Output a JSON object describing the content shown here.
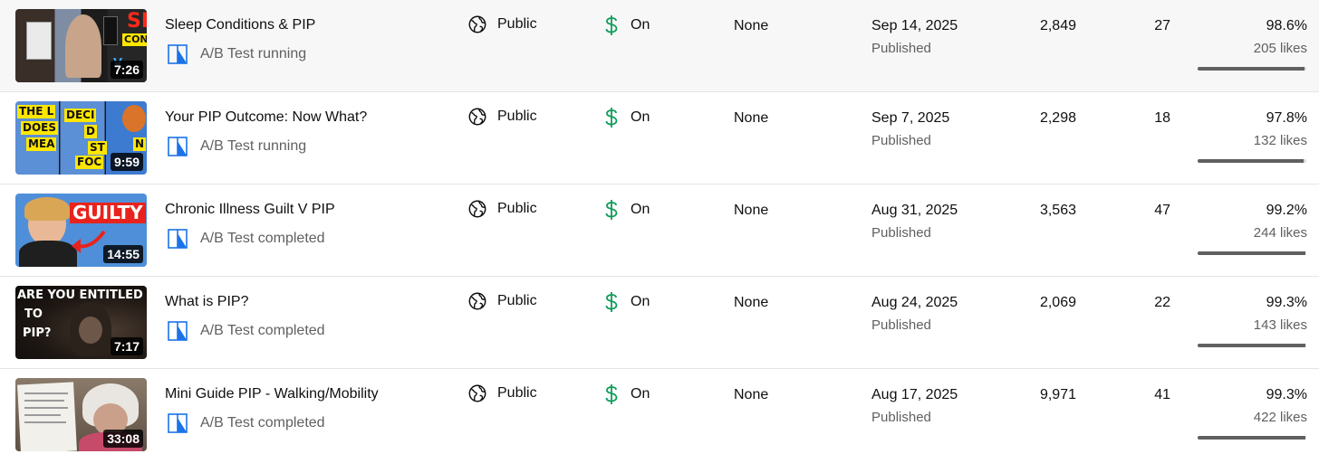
{
  "colors": {
    "ab_icon_blue": "#1a73e8",
    "dollar_green": "#0f9d58",
    "bar_fill": "#606060",
    "bar_track": "#d9d9d9"
  },
  "icons": {
    "visibility": "globe-icon",
    "monetization": "dollar-icon",
    "ab_test": "ab-test-icon"
  },
  "videos": [
    {
      "title": "Sleep Conditions & PIP",
      "ab_status": "A/B Test running",
      "duration": "7:26",
      "thumb_text": [
        "SL",
        "CONDI",
        "V"
      ],
      "visibility": "Public",
      "monetization": "On",
      "restrictions": "None",
      "date": "Sep 14, 2025",
      "date_status": "Published",
      "views": "2,849",
      "comments": "27",
      "likes_pct": "98.6%",
      "likes_count": "205 likes",
      "likes_fraction": 0.986
    },
    {
      "title": "Your PIP Outcome: Now What?",
      "ab_status": "A/B Test running",
      "duration": "9:59",
      "thumb_text": [
        "THE L",
        "DOES",
        "MEA",
        "DECI",
        "D",
        "ST",
        "FOC",
        "N"
      ],
      "visibility": "Public",
      "monetization": "On",
      "restrictions": "None",
      "date": "Sep 7, 2025",
      "date_status": "Published",
      "views": "2,298",
      "comments": "18",
      "likes_pct": "97.8%",
      "likes_count": "132 likes",
      "likes_fraction": 0.978
    },
    {
      "title": "Chronic Illness Guilt V PIP",
      "ab_status": "A/B Test completed",
      "duration": "14:55",
      "thumb_text": [
        "GUILTY"
      ],
      "visibility": "Public",
      "monetization": "On",
      "restrictions": "None",
      "date": "Aug 31, 2025",
      "date_status": "Published",
      "views": "3,563",
      "comments": "47",
      "likes_pct": "99.2%",
      "likes_count": "244 likes",
      "likes_fraction": 0.992
    },
    {
      "title": "What is PIP?",
      "ab_status": "A/B Test completed",
      "duration": "7:17",
      "thumb_text": [
        "ARE YOU ENTITLED",
        "TO",
        "PIP?"
      ],
      "visibility": "Public",
      "monetization": "On",
      "restrictions": "None",
      "date": "Aug 24, 2025",
      "date_status": "Published",
      "views": "2,069",
      "comments": "22",
      "likes_pct": "99.3%",
      "likes_count": "143 likes",
      "likes_fraction": 0.993
    },
    {
      "title": "Mini Guide PIP - Walking/Mobility",
      "ab_status": "A/B Test completed",
      "duration": "33:08",
      "thumb_text": [],
      "visibility": "Public",
      "monetization": "On",
      "restrictions": "None",
      "date": "Aug 17, 2025",
      "date_status": "Published",
      "views": "9,971",
      "comments": "41",
      "likes_pct": "99.3%",
      "likes_count": "422 likes",
      "likes_fraction": 0.993
    }
  ]
}
